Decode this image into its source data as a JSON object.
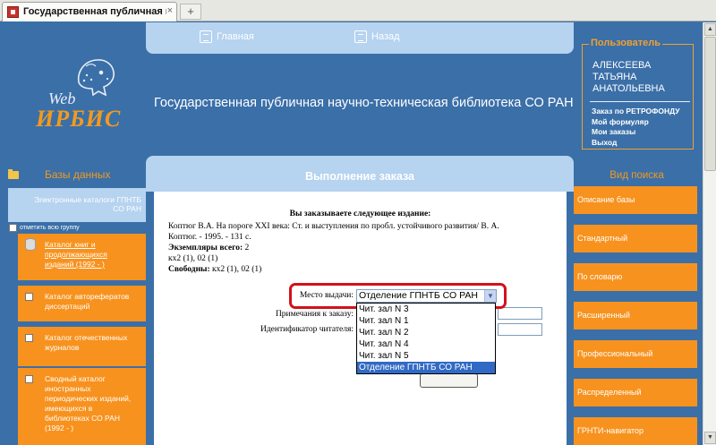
{
  "browser": {
    "tab_title": "Государственная публичная научно-...",
    "tab_close": "×",
    "new_tab": "+"
  },
  "logo": {
    "web": "Web",
    "irbis": "ИРБИС"
  },
  "nav": {
    "home": "Главная",
    "back": "Назад"
  },
  "site_title": "Государственная публичная научно-техническая библиотека СО РАН",
  "user": {
    "panel_title": "Пользователь",
    "name_lines": [
      "АЛЕКСЕЕВА",
      "ТАТЬЯНА",
      "АНАТОЛЬЕВНА"
    ],
    "links": [
      "Заказ по РЕТРОФОНДУ",
      "Мой формуляр",
      "Мои заказы",
      "Выход"
    ]
  },
  "left": {
    "header": "Базы данных",
    "selected_lines": [
      "Электронные каталоги ГПНТБ",
      "СО РАН"
    ],
    "select_all": "отметить всю группу",
    "items": [
      {
        "lines": [
          "Каталог книг и",
          "продолжающихся",
          "изданий (1992 - )"
        ]
      },
      {
        "lines": [
          "Каталог авторефератов",
          "диссертаций"
        ]
      },
      {
        "lines": [
          "Каталог отечественных",
          "журналов"
        ]
      },
      {
        "lines": [
          "Сводный каталог",
          "иностранных",
          "периодических изданий,",
          "имеющихся в",
          "библиотеках СО РАН",
          "(1992 - )"
        ]
      }
    ]
  },
  "center": {
    "header": "Выполнение заказа",
    "heading": "Вы заказываете следующее издание:",
    "desc": {
      "citation_lines": [
        "Коптюг В.А. На пороге XXI века: Ст. и выступления по пробл. устойчивого развития/ В. А.",
        "Коптюг. - 1995. - 131 с."
      ],
      "copies_label": "Экземпляры всего:",
      "copies_value": " 2",
      "holdings": "кх2 (1), 02 (1)",
      "free_label": "Свободны:",
      "free_value": " кх2 (1), 02 (1)"
    },
    "form": {
      "place_label": "Место выдачи:",
      "place_value": "Отделение ГПНТБ СО РАН",
      "note_label": "Примечания к заказу:",
      "reader_label": "Идентификатор читателя:",
      "options": [
        "Чит. зал N 3",
        "Чит. зал N 1",
        "Чит. зал N 2",
        "Чит. зал N 4",
        "Чит. зал N 5",
        "Отделение ГПНТБ СО РАН"
      ]
    }
  },
  "right": {
    "header": "Вид поиска",
    "items": [
      "Описание базы",
      "Стандартный",
      "По словарю",
      "Расширенный",
      "Профессиональный",
      "Распределенный",
      "ГРНТИ-навигатор"
    ]
  },
  "colors": {
    "orange": "#f7921e",
    "blue_bg": "#3b6fa8",
    "light_blue": "#b6d3f0",
    "highlight_red": "#d1121b"
  }
}
